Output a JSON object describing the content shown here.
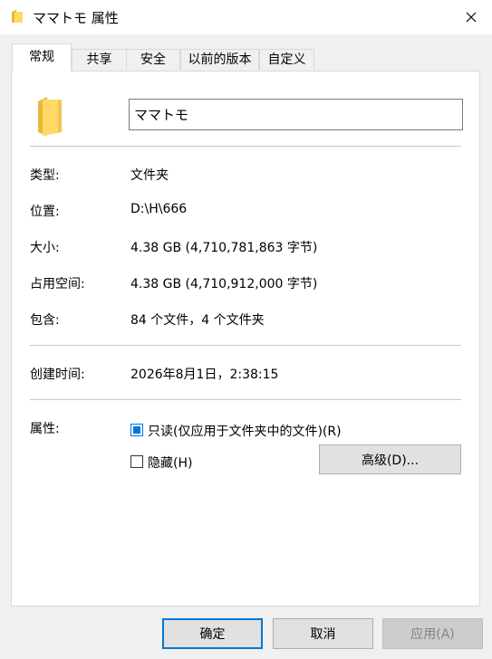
{
  "window": {
    "title": "ママトモ 属性"
  },
  "tabs": [
    {
      "label": "常规",
      "active": true
    },
    {
      "label": "共享",
      "active": false
    },
    {
      "label": "安全",
      "active": false
    },
    {
      "label": "以前的版本",
      "active": false
    },
    {
      "label": "自定义",
      "active": false
    }
  ],
  "general": {
    "folder_name": "ママトモ",
    "type_label": "类型:",
    "type_value": "文件夹",
    "location_label": "位置:",
    "location_value": "D:\\H\\666",
    "size_label": "大小:",
    "size_value": "4.38 GB (4,710,781,863 字节)",
    "size_on_disk_label": "占用空间:",
    "size_on_disk_value": "4.38 GB (4,710,912,000 字节)",
    "contains_label": "包含:",
    "contains_value": "84 个文件，4 个文件夹",
    "created_label": "创建时间:",
    "created_value": "2026年8月1日，2:38:15",
    "attributes_label": "属性:",
    "readonly_label": "只读(仅应用于文件夹中的文件)(R)",
    "readonly_state": "indeterminate",
    "hidden_label": "隐藏(H)",
    "hidden_state": "unchecked",
    "advanced_label": "高级(D)..."
  },
  "footer": {
    "ok_label": "确定",
    "cancel_label": "取消",
    "apply_label": "应用(A)"
  },
  "icons": {
    "folder": "folder-icon",
    "close": "close-icon"
  },
  "colors": {
    "accent": "#0078d7",
    "folder": "#ffd868"
  }
}
